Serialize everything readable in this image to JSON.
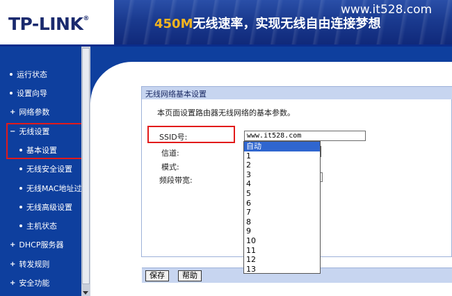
{
  "header": {
    "logo": "TP-LINK",
    "logo_mark": "®",
    "banner_highlight": "450M",
    "banner_text": "无线速率，实现无线自由连接梦想",
    "watermark": "www.it528.com"
  },
  "sidebar": {
    "items": [
      {
        "label": "运行状态",
        "marker": "•"
      },
      {
        "label": "设置向导",
        "marker": "•"
      },
      {
        "label": "网络参数",
        "marker": "+"
      },
      {
        "label": "无线设置",
        "marker": "−"
      },
      {
        "label": "基本设置",
        "marker": "•"
      },
      {
        "label": "无线安全设置",
        "marker": "•"
      },
      {
        "label": "无线MAC地址过滤",
        "marker": "•"
      },
      {
        "label": "无线高级设置",
        "marker": "•"
      },
      {
        "label": "主机状态",
        "marker": "•"
      },
      {
        "label": "DHCP服务器",
        "marker": "+"
      },
      {
        "label": "转发规则",
        "marker": "+"
      },
      {
        "label": "安全功能",
        "marker": "+"
      }
    ]
  },
  "panel": {
    "title": "无线网络基本设置",
    "description": "本页面设置路由器无线网络的基本参数。",
    "ssid_label": "SSID号:",
    "ssid_value": "www.it528.com",
    "channel_label": "信道:",
    "channel_value": "自动",
    "mode_label": "模式:",
    "bandwidth_label": "频段带宽:",
    "channel_options": [
      "自动",
      "1",
      "2",
      "3",
      "4",
      "5",
      "6",
      "7",
      "8",
      "9",
      "10",
      "11",
      "12",
      "13"
    ],
    "save_label": "保存",
    "help_label": "帮助"
  },
  "colors": {
    "nav_blue": "#0e3f9e",
    "highlight_red": "#e21a1a",
    "selected_option": "#2f66cf",
    "panel_header": "#c7d5f0"
  }
}
